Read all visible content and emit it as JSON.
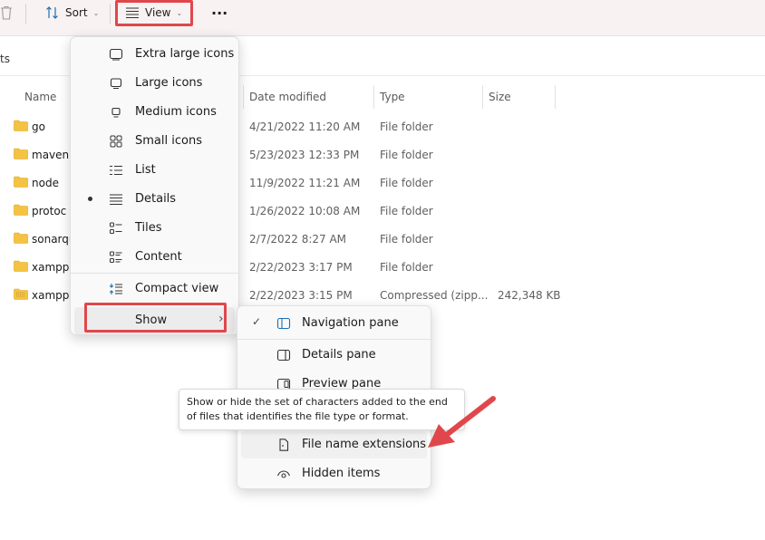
{
  "toolbar": {
    "sort_label": "Sort",
    "view_label": "View",
    "more_label": "···"
  },
  "address": {
    "text": "ts"
  },
  "columns": {
    "name": "Name",
    "date": "Date modified",
    "type": "Type",
    "size": "Size"
  },
  "rows": [
    {
      "name": "go",
      "date": "4/21/2022 11:20 AM",
      "type": "File folder",
      "size": ""
    },
    {
      "name": "maven",
      "date": "5/23/2023 12:33 PM",
      "type": "File folder",
      "size": ""
    },
    {
      "name": "node",
      "date": "11/9/2022 11:21 AM",
      "type": "File folder",
      "size": ""
    },
    {
      "name": "protoc",
      "date": "1/26/2022 10:08 AM",
      "type": "File folder",
      "size": ""
    },
    {
      "name": "sonarqu",
      "date": "2/7/2022 8:27 AM",
      "type": "File folder",
      "size": ""
    },
    {
      "name": "xampp-",
      "date": "2/22/2023 3:17 PM",
      "type": "File folder",
      "size": ""
    },
    {
      "name": "xampp-",
      "date": "2/22/2023 3:15 PM",
      "type": "Compressed (zipp...",
      "size": "242,348 KB"
    }
  ],
  "view_menu": {
    "items": [
      {
        "label": "Extra large icons",
        "icon": "extra-large-icons-icon"
      },
      {
        "label": "Large icons",
        "icon": "large-icons-icon"
      },
      {
        "label": "Medium icons",
        "icon": "medium-icons-icon"
      },
      {
        "label": "Small icons",
        "icon": "small-icons-icon"
      },
      {
        "label": "List",
        "icon": "list-icon"
      },
      {
        "label": "Details",
        "icon": "details-icon",
        "selected": true
      },
      {
        "label": "Tiles",
        "icon": "tiles-icon"
      },
      {
        "label": "Content",
        "icon": "content-icon"
      }
    ],
    "compact": {
      "label": "Compact view",
      "icon": "compact-view-icon"
    },
    "show": {
      "label": "Show",
      "chevron": "›"
    }
  },
  "show_menu": {
    "items": [
      {
        "label": "Navigation pane",
        "icon": "navigation-pane-icon",
        "checked": true
      },
      {
        "label": "Details pane",
        "icon": "details-pane-icon"
      },
      {
        "label": "Preview pane",
        "icon": "preview-pane-icon"
      },
      {
        "label": "File name extensions",
        "icon": "file-extension-icon"
      },
      {
        "label": "Hidden items",
        "icon": "hidden-items-icon"
      }
    ]
  },
  "tooltip": {
    "text": "Show or hide the set of characters added to the end of files that identifies the file type or format."
  },
  "colors": {
    "highlight": "#e0474c",
    "arrow": "#e0474c",
    "folder": "#f5c342"
  }
}
